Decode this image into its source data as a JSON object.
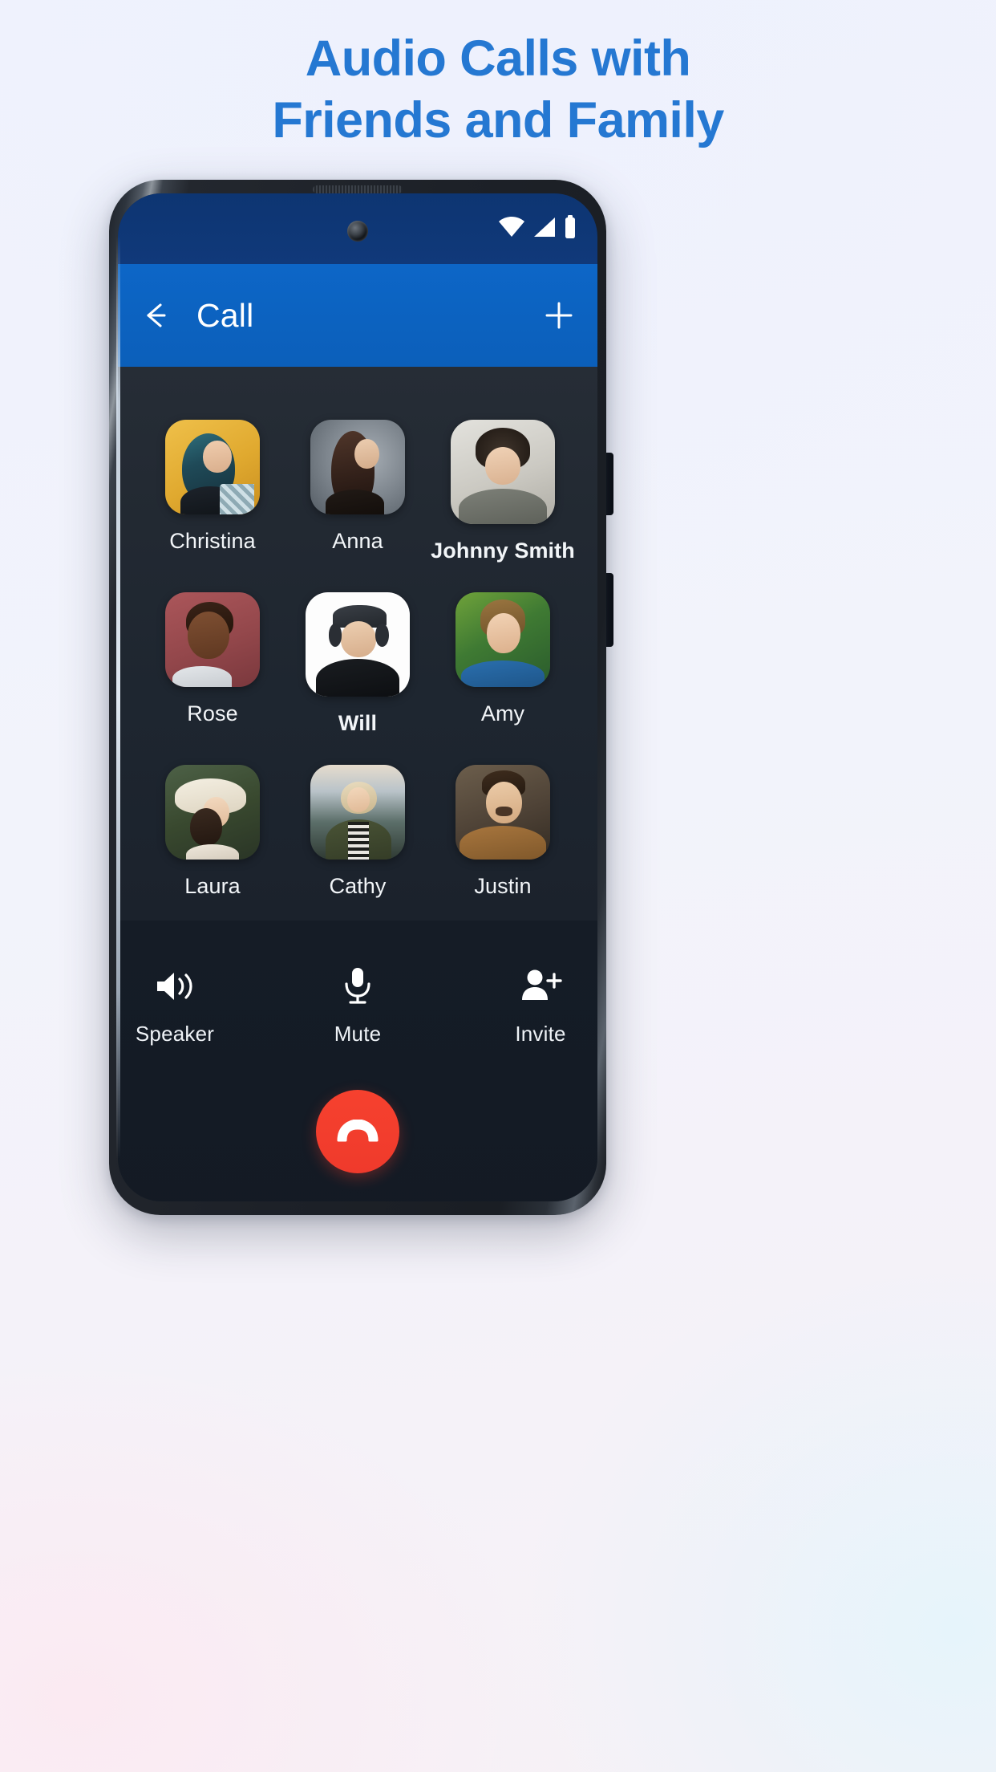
{
  "headline": {
    "line1": "Audio Calls with",
    "line2": "Friends and Family",
    "color": "#2578d2"
  },
  "phone": {
    "status_bar": {
      "background": "#0d3572",
      "icons": [
        "wifi-icon",
        "cellular-signal-icon",
        "battery-icon"
      ],
      "camera": "front-camera-punch-hole"
    },
    "app_bar": {
      "background": "#0d66c7",
      "back_icon": "arrow-left-icon",
      "title": "Call",
      "add_icon": "plus-icon"
    },
    "participants": {
      "background": "#222932",
      "rows": [
        [
          {
            "name": "Christina",
            "active": false,
            "photo": "woman-yellow-wall",
            "bg": "#e8b53c"
          },
          {
            "name": "Anna",
            "active": false,
            "photo": "woman-profile-grey",
            "bg": "#8d949c"
          },
          {
            "name": "Johnny Smith",
            "active": true,
            "photo": "man-curly-hair-hat",
            "bg": "#cfcfcb"
          }
        ],
        [
          {
            "name": "Rose",
            "active": false,
            "photo": "woman-red-backdrop",
            "bg": "#9d4d50"
          },
          {
            "name": "Will",
            "active": true,
            "photo": "man-headphones-cap",
            "bg": "#ffffff"
          },
          {
            "name": "Amy",
            "active": false,
            "photo": "woman-green-outdoors",
            "bg": "#3f7a3a"
          }
        ],
        [
          {
            "name": "Laura",
            "active": false,
            "photo": "woman-sun-hat-garden",
            "bg": "#3c5040"
          },
          {
            "name": "Cathy",
            "active": false,
            "photo": "woman-blonde-landscape",
            "bg": "#5e6f78"
          },
          {
            "name": "Justin",
            "active": false,
            "photo": "man-beard-sweater",
            "bg": "#7a5a3a"
          }
        ]
      ]
    },
    "controls": {
      "background": "#131a24",
      "buttons": [
        {
          "label": "Speaker",
          "icon": "speaker-volume-icon"
        },
        {
          "label": "Mute",
          "icon": "microphone-icon"
        },
        {
          "label": "Invite",
          "icon": "person-add-icon"
        }
      ],
      "end_call": {
        "icon": "phone-hangup-icon",
        "color": "#ef3a2c"
      }
    },
    "hardware": {
      "earpiece": "speaker-grille",
      "side_buttons": [
        "power-button",
        "volume-rocker"
      ]
    }
  }
}
